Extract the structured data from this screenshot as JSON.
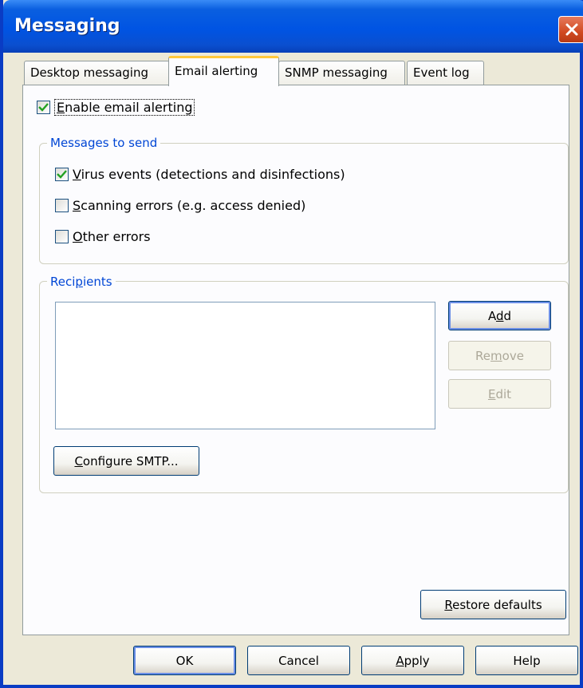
{
  "window": {
    "title": "Messaging"
  },
  "tabs": [
    {
      "label": "Desktop messaging",
      "active": false
    },
    {
      "label": "Email alerting",
      "active": true
    },
    {
      "label": "SNMP messaging",
      "active": false
    },
    {
      "label": "Event log",
      "active": false
    }
  ],
  "enable_email": {
    "pre": "",
    "key": "E",
    "post": "nable email alerting",
    "checked": true
  },
  "messages_group": {
    "label": "Messages to send",
    "items": [
      {
        "pre": "",
        "key": "V",
        "post": "irus events (detections and disinfections)",
        "checked": true
      },
      {
        "pre": "",
        "key": "S",
        "post": "canning errors (e.g. access denied)",
        "checked": false
      },
      {
        "pre": "",
        "key": "O",
        "post": "ther errors",
        "checked": false
      }
    ]
  },
  "recipients_group": {
    "label_pre": "Reci",
    "label_key": "p",
    "label_post": "ients",
    "add": {
      "pre": "A",
      "key": "d",
      "post": "d"
    },
    "remove": {
      "pre": "Re",
      "key": "m",
      "post": "ove"
    },
    "edit": {
      "pre": "",
      "key": "E",
      "post": "dit"
    },
    "configure": {
      "pre": "",
      "key": "C",
      "post": "onfigure SMTP..."
    }
  },
  "restore": {
    "pre": "",
    "key": "R",
    "post": "estore defaults"
  },
  "footer": {
    "ok": "OK",
    "cancel": "Cancel",
    "apply": {
      "pre": "",
      "key": "A",
      "post": "pply"
    },
    "help": "Help"
  },
  "colors": {
    "title_bar": "#0054e3",
    "group_label": "#0046d5",
    "active_tab_highlight": "#ffc83c"
  }
}
